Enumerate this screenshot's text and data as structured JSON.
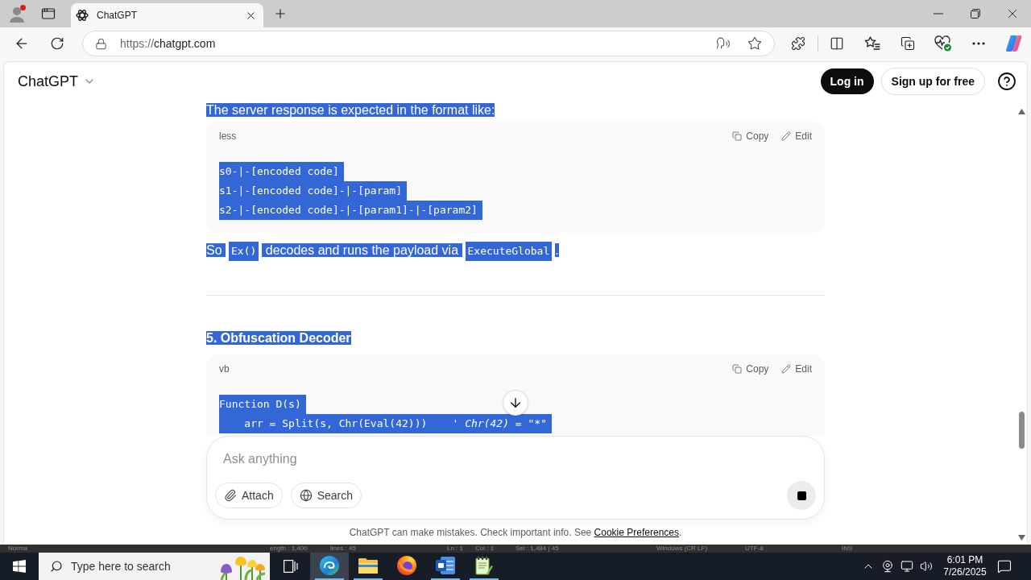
{
  "browser": {
    "tabs": [
      {
        "title": "ChatGPT",
        "selected": true
      }
    ],
    "address": {
      "scheme": "https://",
      "host": "chatgpt.com"
    }
  },
  "site_header": {
    "title": "ChatGPT",
    "buttons": [
      {
        "kind": "primary",
        "label": "Log in"
      },
      {
        "kind": "outline",
        "label": "Sign up for free"
      }
    ]
  },
  "conversation": [
    {
      "kind": "paragraph",
      "highlighted": true,
      "segments": [
        {
          "kind": "text",
          "text": "The server response is expected in the format like:"
        }
      ]
    },
    {
      "kind": "code",
      "language": "less",
      "highlighted": true,
      "actions": [
        {
          "kind": "copy",
          "label": "Copy"
        },
        {
          "kind": "edit",
          "label": "Edit"
        }
      ],
      "lines": [
        {
          "code": "s0-|-[encoded code]"
        },
        {
          "code": "s1-|-[encoded code]-|-[param]"
        },
        {
          "code": "s2-|-[encoded code]-|-[param1]-|-[param2]"
        }
      ]
    },
    {
      "kind": "paragraph",
      "highlighted": true,
      "segments": [
        {
          "kind": "text",
          "text": "So "
        },
        {
          "kind": "code",
          "text": "Ex()"
        },
        {
          "kind": "text",
          "text": " decodes and runs the payload via "
        },
        {
          "kind": "code",
          "text": "ExecuteGlobal"
        },
        {
          "kind": "text",
          "text": "."
        }
      ]
    },
    {
      "kind": "rule"
    },
    {
      "kind": "heading",
      "highlighted": true,
      "text": "5. Obfuscation Decoder"
    },
    {
      "kind": "code",
      "language": "vb",
      "highlighted": true,
      "actions": [
        {
          "kind": "copy",
          "label": "Copy"
        },
        {
          "kind": "edit",
          "label": "Edit"
        }
      ],
      "lines": [
        {
          "code": "Function D(s)"
        },
        {
          "code": "    arr = Split(s, Chr(Eval(42)))",
          "comment": "' Chr(42) = \"*\""
        }
      ]
    }
  ],
  "composer": {
    "placeholder": "Ask anything",
    "tools": [
      {
        "kind": "attach",
        "label": "Attach"
      },
      {
        "kind": "search",
        "label": "Search"
      }
    ]
  },
  "disclaimer": {
    "text": "ChatGPT can make mistakes. Check important info. See",
    "link": "Cookie Preferences",
    "end": "."
  },
  "background_window_status": [
    "Norma",
    "ength : 1,400",
    "lines : 45",
    "Ln : 1",
    "Col : 1",
    "Sel : 1,484 | 45",
    "Windows (CR LF)",
    "UTF-8",
    "INS"
  ],
  "taskbar": {
    "search_placeholder": "Type here to search",
    "apps": [
      {
        "kind": "edge",
        "selected": true,
        "running": true
      },
      {
        "kind": "explorer",
        "selected": false,
        "running": true
      },
      {
        "kind": "firefox",
        "selected": false,
        "running": false
      },
      {
        "kind": "word",
        "selected": false,
        "running": true
      },
      {
        "kind": "notepad",
        "selected": false,
        "running": true
      }
    ],
    "time": "6:01 PM",
    "date": "7/26/2025"
  }
}
